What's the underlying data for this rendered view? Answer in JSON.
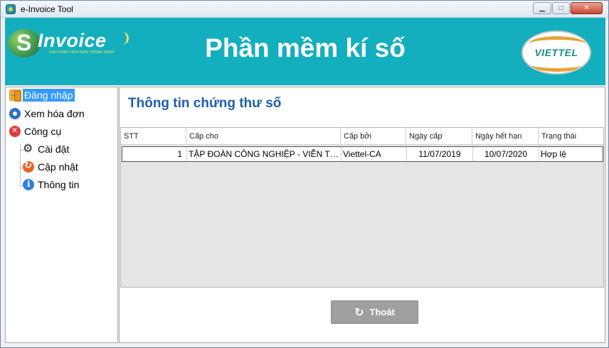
{
  "window": {
    "title": "e-Invoice Tool",
    "minimize_glyph": "▁",
    "maximize_glyph": "□",
    "close_glyph": "✕"
  },
  "header": {
    "logo_s": "S",
    "logo_word": "Invoice",
    "logo_tagline": "GIẢI PHÁP HÓA ĐƠN THÔNG MINH",
    "title": "Phần mềm kí số",
    "brand": "VIETTEL",
    "background_color": "#14afbe"
  },
  "sidebar": {
    "items": [
      {
        "label": "Đăng nhập",
        "icon": "login-icon",
        "selected": true
      },
      {
        "label": "Xem hóa đơn",
        "icon": "eye-icon",
        "selected": false
      },
      {
        "label": "Công cụ",
        "icon": "tools-icon",
        "selected": false
      },
      {
        "label": "Cài đặt",
        "icon": "gear-icon",
        "selected": false
      },
      {
        "label": "Cập nhật",
        "icon": "update-icon",
        "selected": false
      },
      {
        "label": "Thông tin",
        "icon": "info-icon",
        "selected": false
      }
    ]
  },
  "main": {
    "title": "Thông tin chứng thư số",
    "title_color": "#1f5fa8",
    "table": {
      "columns": [
        "STT",
        "Cấp cho",
        "Cấp bởi",
        "Ngày cấp",
        "Ngày hết hạn",
        "Trạng thái"
      ],
      "rows": [
        [
          "1",
          "TẬP ĐOÀN CÔNG NGHIỆP - VIỄN TH...",
          "Viettel-CA",
          "11/07/2019",
          "10/07/2020",
          "Hợp lệ"
        ]
      ]
    },
    "exit_button": {
      "label": "Thoát",
      "icon": "refresh-icon"
    }
  }
}
